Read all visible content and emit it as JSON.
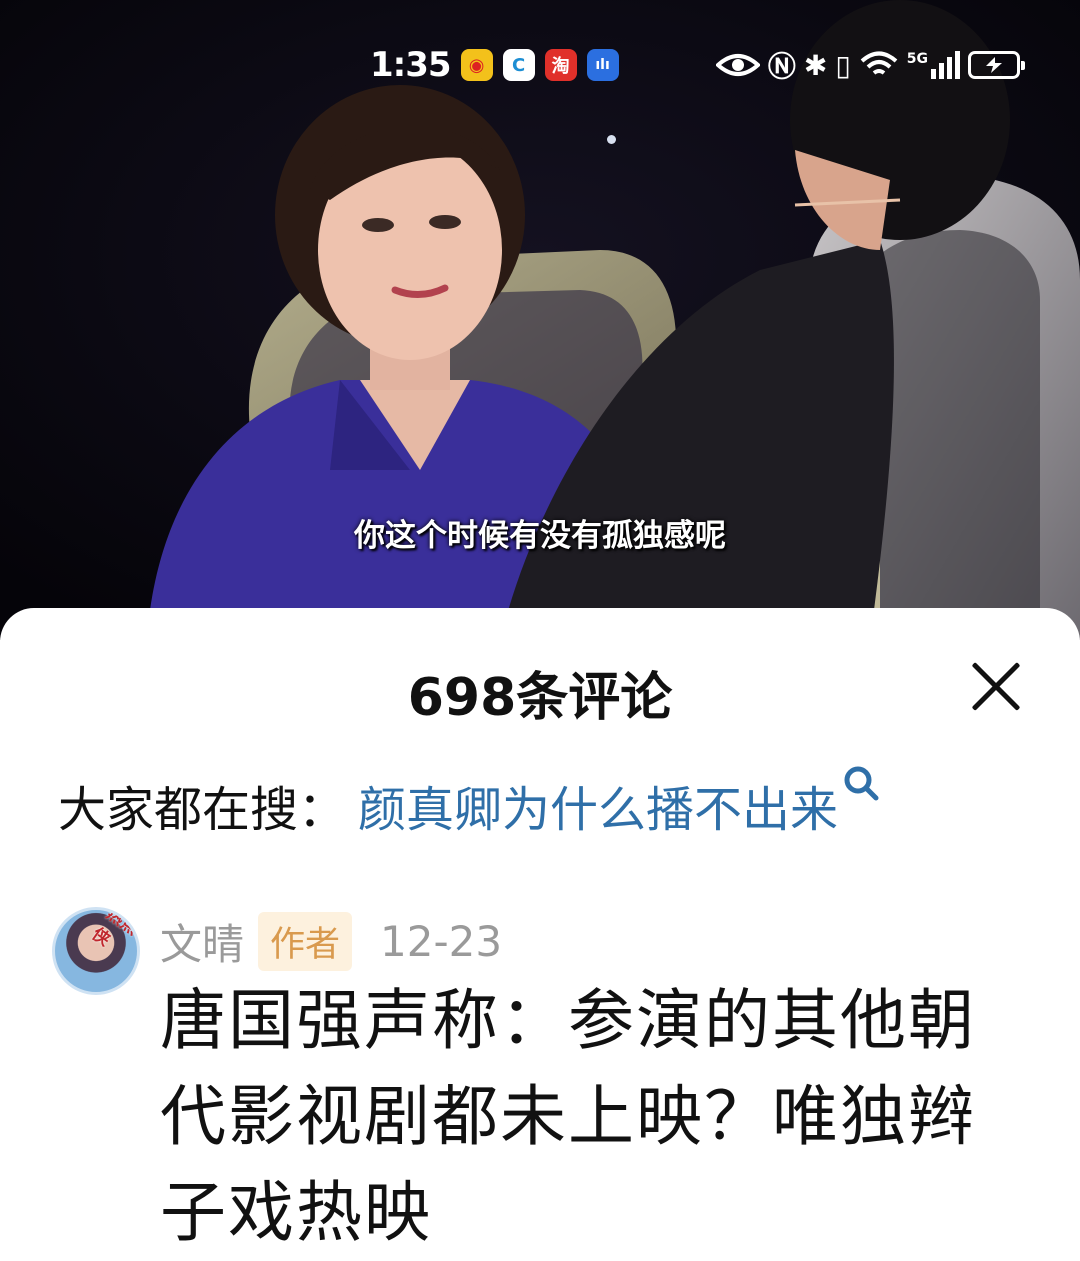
{
  "status_bar": {
    "time": "1:35",
    "app_icons": [
      "weibo-icon",
      "browser-icon",
      "taobao-icon",
      "voice-app-icon"
    ],
    "right_icons": [
      "eye-icon",
      "nfc-icon",
      "bluetooth-icon",
      "vibrate-icon",
      "wifi-icon",
      "signal-5g-icon",
      "battery-charging-icon"
    ],
    "network": "5G"
  },
  "video": {
    "subtitle": "你这个时候有没有孤独感呢"
  },
  "comments_panel": {
    "title": "698条评论",
    "search_suggestion": {
      "label": "大家都在搜：",
      "term": "颜真卿为什么播不出来"
    },
    "comment": {
      "author": "文晴",
      "author_tag": "作者",
      "date": "12-23",
      "avatar_badge": "热点侠",
      "text": "唐国强声称：参演的其他朝代影视剧都未上映？唯独辫子戏热映"
    }
  },
  "colors": {
    "search_term": "#2f6fa8",
    "author_tag_bg": "#fdf1de",
    "author_tag_text": "#d99a4e",
    "meta_gray": "#9a9a9a"
  }
}
